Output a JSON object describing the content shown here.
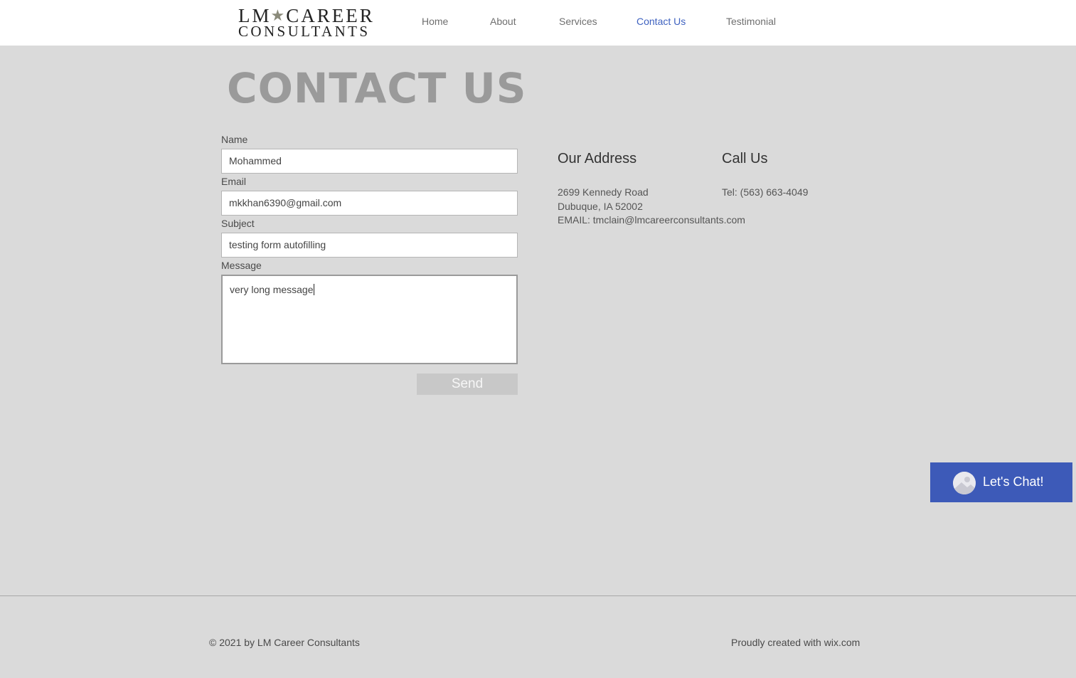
{
  "header": {
    "logo": {
      "line1_left": "LM",
      "line1_right": "CAREER",
      "line2": "CONSULTANTS"
    },
    "nav": [
      {
        "label": "Home",
        "active": false
      },
      {
        "label": "About",
        "active": false
      },
      {
        "label": "Services",
        "active": false
      },
      {
        "label": "Contact Us",
        "active": true
      },
      {
        "label": "Testimonial",
        "active": false
      }
    ]
  },
  "page": {
    "title": "CONTACT US"
  },
  "form": {
    "name": {
      "label": "Name",
      "value": "Mohammed"
    },
    "email": {
      "label": "Email",
      "value": "mkkhan6390@gmail.com"
    },
    "subject": {
      "label": "Subject",
      "value": "testing form autofilling"
    },
    "message": {
      "label": "Message",
      "value": "very long message"
    },
    "send_label": "Send"
  },
  "contact": {
    "address_heading": "Our Address",
    "address_line1": "2699 Kennedy Road",
    "address_line2": "Dubuque, IA  52002",
    "email_line": "EMAIL:  tmclain@lmcareerconsultants.com",
    "call_heading": "Call Us",
    "tel_line": "Tel: (563) 663-4049"
  },
  "chat": {
    "label": "Let's Chat!",
    "icon": "avatar-icon"
  },
  "footer": {
    "copyright": "© 2021 by LM Career Consultants",
    "credit": "Proudly created with wix.com"
  },
  "colors": {
    "accent": "#3f62c0",
    "chat_bg": "#3d5ab8",
    "page_bg": "#dadada"
  }
}
